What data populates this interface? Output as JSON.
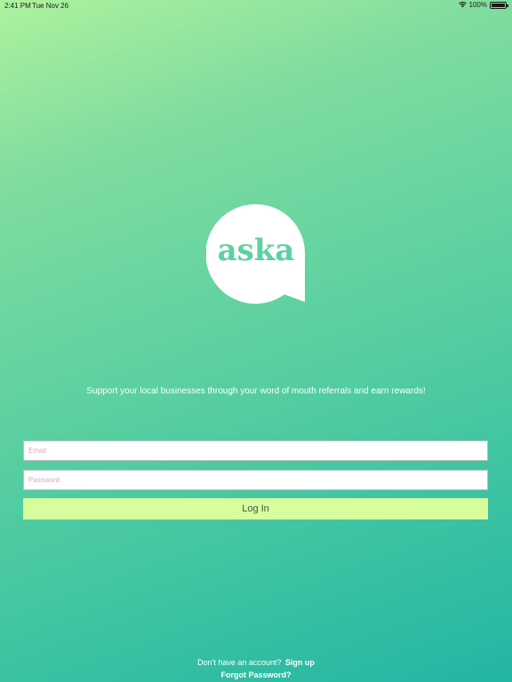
{
  "status_bar": {
    "time": "2:41 PM",
    "date": "Tue Nov 26",
    "battery": "100%",
    "battery_level": 1.0,
    "wifi_icon": "wifi-icon",
    "battery_icon": "battery-icon"
  },
  "logo": {
    "text": "aska",
    "bubble_color": "#ffffff",
    "text_color": "#5fd1a0"
  },
  "tagline": "Support your local businesses through your word of mouth referrals and earn rewards!",
  "form": {
    "email_placeholder": "Email",
    "email_value": "",
    "password_placeholder": "Password",
    "password_value": "",
    "login_label": "Log In",
    "login_color": "#d7fd9c"
  },
  "footer": {
    "signup_prompt": "Don't have an account?",
    "signup_link": "Sign up",
    "forgot_link": "Forgot Password?"
  },
  "colors": {
    "gradient_start": "#aef29e",
    "gradient_end": "#22b5a3"
  }
}
